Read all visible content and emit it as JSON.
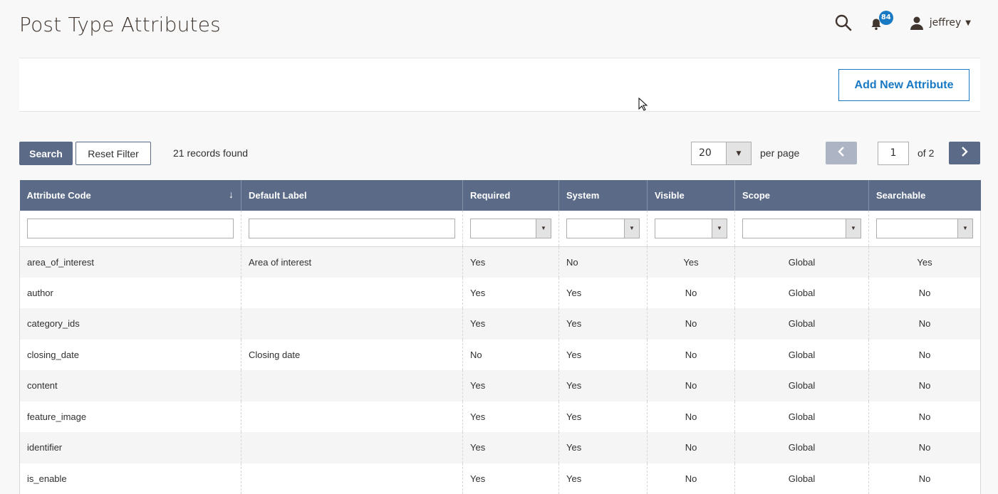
{
  "header": {
    "title": "Post Type Attributes",
    "notifications_count": "84",
    "user_name": "jeffrey",
    "icons": [
      "search-icon",
      "bell-icon",
      "user-icon",
      "caret-down-icon"
    ]
  },
  "actions": {
    "add_new_label": "Add New Attribute"
  },
  "toolbar": {
    "search_label": "Search",
    "reset_label": "Reset Filter",
    "records_found": "21 records found",
    "per_page_value": "20",
    "per_page_label": "per page",
    "current_page": "1",
    "of_pages": "of 2"
  },
  "grid": {
    "columns": [
      "Attribute Code",
      "Default Label",
      "Required",
      "System",
      "Visible",
      "Scope",
      "Searchable"
    ],
    "sort_indicator": "↓",
    "rows": [
      {
        "code": "area_of_interest",
        "label": "Area of interest",
        "required": "Yes",
        "system": "No",
        "visible": "Yes",
        "scope": "Global",
        "searchable": "Yes"
      },
      {
        "code": "author",
        "label": "",
        "required": "Yes",
        "system": "Yes",
        "visible": "No",
        "scope": "Global",
        "searchable": "No"
      },
      {
        "code": "category_ids",
        "label": "",
        "required": "Yes",
        "system": "Yes",
        "visible": "No",
        "scope": "Global",
        "searchable": "No"
      },
      {
        "code": "closing_date",
        "label": "Closing date",
        "required": "No",
        "system": "Yes",
        "visible": "No",
        "scope": "Global",
        "searchable": "No"
      },
      {
        "code": "content",
        "label": "",
        "required": "Yes",
        "system": "Yes",
        "visible": "No",
        "scope": "Global",
        "searchable": "No"
      },
      {
        "code": "feature_image",
        "label": "",
        "required": "Yes",
        "system": "Yes",
        "visible": "No",
        "scope": "Global",
        "searchable": "No"
      },
      {
        "code": "identifier",
        "label": "",
        "required": "Yes",
        "system": "Yes",
        "visible": "No",
        "scope": "Global",
        "searchable": "No"
      },
      {
        "code": "is_enable",
        "label": "",
        "required": "Yes",
        "system": "Yes",
        "visible": "No",
        "scope": "Global",
        "searchable": "No"
      }
    ]
  }
}
